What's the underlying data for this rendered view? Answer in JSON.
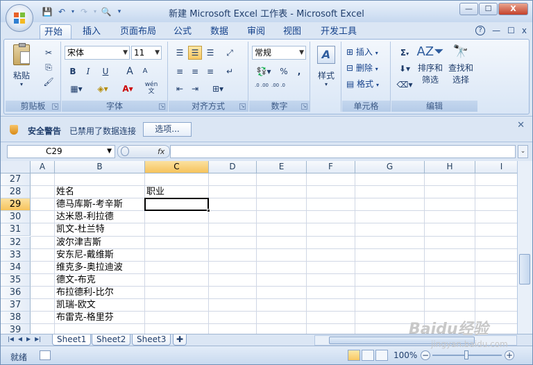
{
  "window": {
    "title": "新建 Microsoft Excel 工作表 - Microsoft Excel",
    "controls": {
      "minimize": "—",
      "maximize": "☐",
      "close": "X"
    }
  },
  "ribbon_tabs": [
    "开始",
    "插入",
    "页面布局",
    "公式",
    "数据",
    "审阅",
    "视图",
    "开发工具"
  ],
  "active_tab": "开始",
  "ribbon_right": {
    "help": "?",
    "min": "—",
    "restore": "☐",
    "close": "x"
  },
  "ribbon": {
    "clipboard": {
      "label": "剪贴板",
      "paste": "粘贴"
    },
    "font": {
      "label": "字体",
      "name": "宋体",
      "size": "11",
      "bold": "B",
      "italic": "I",
      "underline": "U",
      "grow": "A",
      "shrink": "A",
      "wen": "wén"
    },
    "alignment": {
      "label": "对齐方式"
    },
    "number": {
      "label": "数字",
      "format": "常规",
      "percent": "%",
      "comma": ",",
      "inc": ".0 .00",
      "dec": ".00 .0"
    },
    "styles": {
      "label": "样式"
    },
    "cells": {
      "label": "单元格",
      "insert": "插入",
      "delete": "删除",
      "format": "格式"
    },
    "editing": {
      "label": "编辑",
      "sort": "排序和\n筛选",
      "sort_l1": "排序和",
      "sort_l2": "筛选",
      "find_l1": "查找和",
      "find_l2": "选择",
      "sum": "Σ"
    }
  },
  "security_bar": {
    "title": "安全警告",
    "message": "已禁用了数据连接",
    "button": "选项..."
  },
  "formula_bar": {
    "name_box": "C29",
    "fx": "fx",
    "formula": ""
  },
  "columns": [
    "A",
    "B",
    "C",
    "D",
    "E",
    "F",
    "G",
    "H",
    "I"
  ],
  "selected_column": "C",
  "rows": [
    "27",
    "28",
    "29",
    "30",
    "31",
    "32",
    "33",
    "34",
    "35",
    "36",
    "37",
    "38",
    "39"
  ],
  "selected_row": "29",
  "cells": {
    "B28": "姓名",
    "C28": "职业",
    "B29": "德马库斯-考辛斯",
    "B30": "达米恩-利拉德",
    "B31": "凯文-杜兰特",
    "B32": "波尔津吉斯",
    "B33": "安东尼-戴维斯",
    "B34": "维克多-奥拉迪波",
    "B35": "德文-布克",
    "B36": "布拉德利-比尔",
    "B37": "凯瑞-欧文",
    "B38": "布雷克-格里芬"
  },
  "sheets": [
    "Sheet1",
    "Sheet2",
    "Sheet3"
  ],
  "active_sheet": "Sheet1",
  "status": {
    "ready": "就绪",
    "zoom": "100%"
  },
  "watermark": {
    "brand": "Baidu经验",
    "url": "jingyan.baidu.com"
  }
}
